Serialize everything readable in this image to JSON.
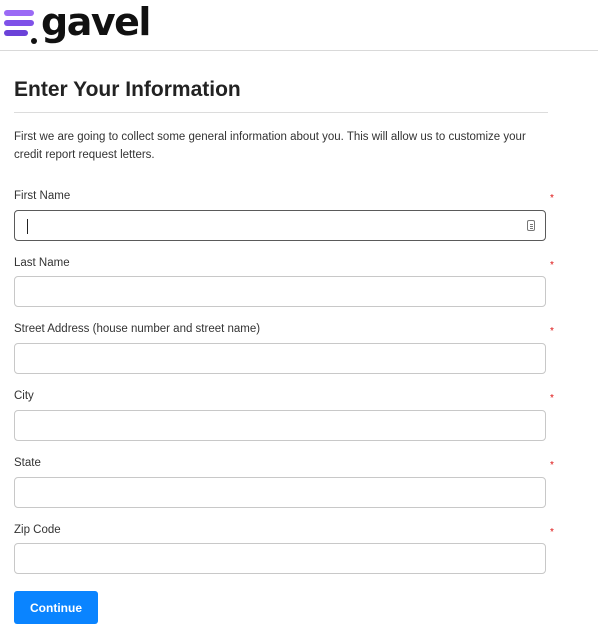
{
  "brand": {
    "name": "gavel",
    "accent": "#8a5cf0"
  },
  "page": {
    "title": "Enter Your Information",
    "intro": "First we are going to collect some general information about you. This will allow us to customize your credit report request letters."
  },
  "fields": [
    {
      "label": "First Name",
      "required_mark": "*",
      "value": "",
      "focused": true
    },
    {
      "label": "Last Name",
      "required_mark": "*",
      "value": ""
    },
    {
      "label": "Street Address (house number and street name)",
      "required_mark": "*",
      "value": ""
    },
    {
      "label": "City",
      "required_mark": "*",
      "value": ""
    },
    {
      "label": "State",
      "required_mark": "*",
      "value": ""
    },
    {
      "label": "Zip Code",
      "required_mark": "*",
      "value": ""
    }
  ],
  "actions": {
    "continue_label": "Continue",
    "button_color": "#0a84ff"
  }
}
